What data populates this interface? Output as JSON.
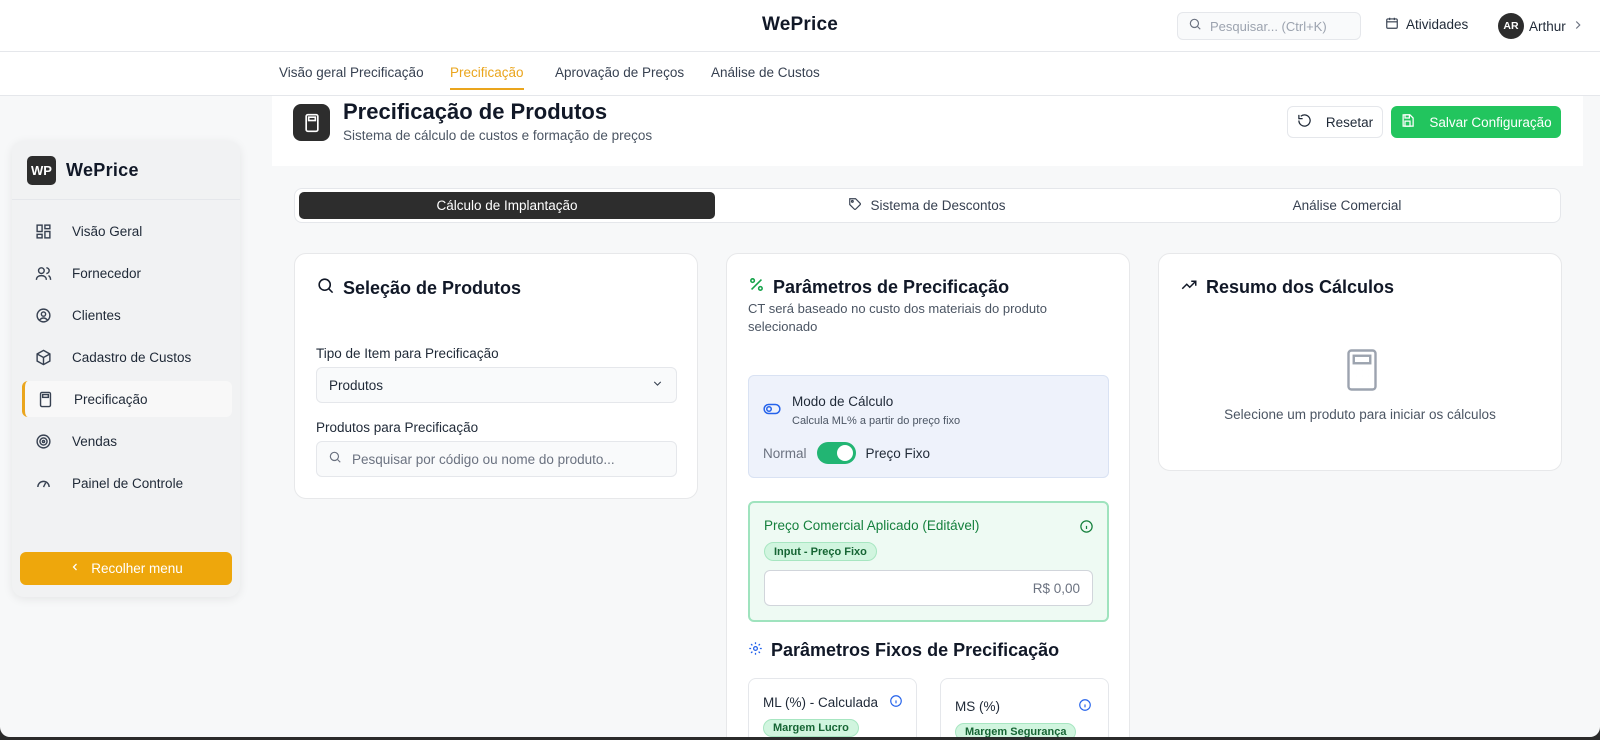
{
  "app": {
    "title": "WePrice",
    "search_placeholder": "Pesquisar... (Ctrl+K)",
    "activities_label": "Atividades",
    "user_initials": "AR",
    "user_name": "Arthur"
  },
  "nav": {
    "tabs": [
      {
        "label": "Visão geral Precificação",
        "active": false
      },
      {
        "label": "Precificação",
        "active": true
      },
      {
        "label": "Aprovação de Preços",
        "active": false
      },
      {
        "label": "Análise de Custos",
        "active": false
      }
    ]
  },
  "sidebar": {
    "logo": "WP",
    "title": "WePrice",
    "items": [
      {
        "label": "Visão Geral",
        "icon": "dashboard-icon"
      },
      {
        "label": "Fornecedor",
        "icon": "users-icon"
      },
      {
        "label": "Clientes",
        "icon": "user-circle-icon"
      },
      {
        "label": "Cadastro de Custos",
        "icon": "package-icon"
      },
      {
        "label": "Precificação",
        "icon": "calculator-icon",
        "active": true
      },
      {
        "label": "Vendas",
        "icon": "target-icon"
      },
      {
        "label": "Painel de Controle",
        "icon": "gauge-icon"
      }
    ],
    "collapse_label": "Recolher menu"
  },
  "header": {
    "title": "Precificação de Produtos",
    "subtitle": "Sistema de cálculo de custos e formação de preços",
    "reset_label": "Resetar",
    "save_label": "Salvar Configuração"
  },
  "subtabs": [
    {
      "label": "Cálculo de Implantação",
      "active": true
    },
    {
      "label": "Sistema de Descontos",
      "active": false
    },
    {
      "label": "Análise Comercial",
      "active": false
    }
  ],
  "selection": {
    "title": "Seleção de Produtos",
    "item_type_label": "Tipo de Item para Precificação",
    "item_type_value": "Produtos",
    "products_label": "Produtos para Precificação",
    "products_placeholder": "Pesquisar por código ou nome do produto..."
  },
  "params": {
    "title": "Parâmetros de Precificação",
    "description": "CT será baseado no custo dos materiais do produto selecionado",
    "mode_title": "Modo de Cálculo",
    "mode_sub": "Calcula ML% a partir do preço fixo",
    "mode_off_label": "Normal",
    "mode_on_label": "Preço Fixo",
    "mode_on": true,
    "price_label": "Preço Comercial Aplicado (Editável)",
    "price_badge": "Input - Preço Fixo",
    "price_value": "R$ 0,00",
    "fixed_title": "Parâmetros Fixos de Precificação",
    "ml_label": "ML (%) - Calculada",
    "ml_badge": "Margem Lucro",
    "ms_label": "MS (%)",
    "ms_badge": "Margem Segurança"
  },
  "summary": {
    "title": "Resumo dos Cálculos",
    "empty_text": "Selecione um produto para iniciar os cálculos"
  },
  "colors": {
    "accent": "#eaa51d",
    "success": "#22c55e",
    "dark": "#2d2d2d"
  }
}
